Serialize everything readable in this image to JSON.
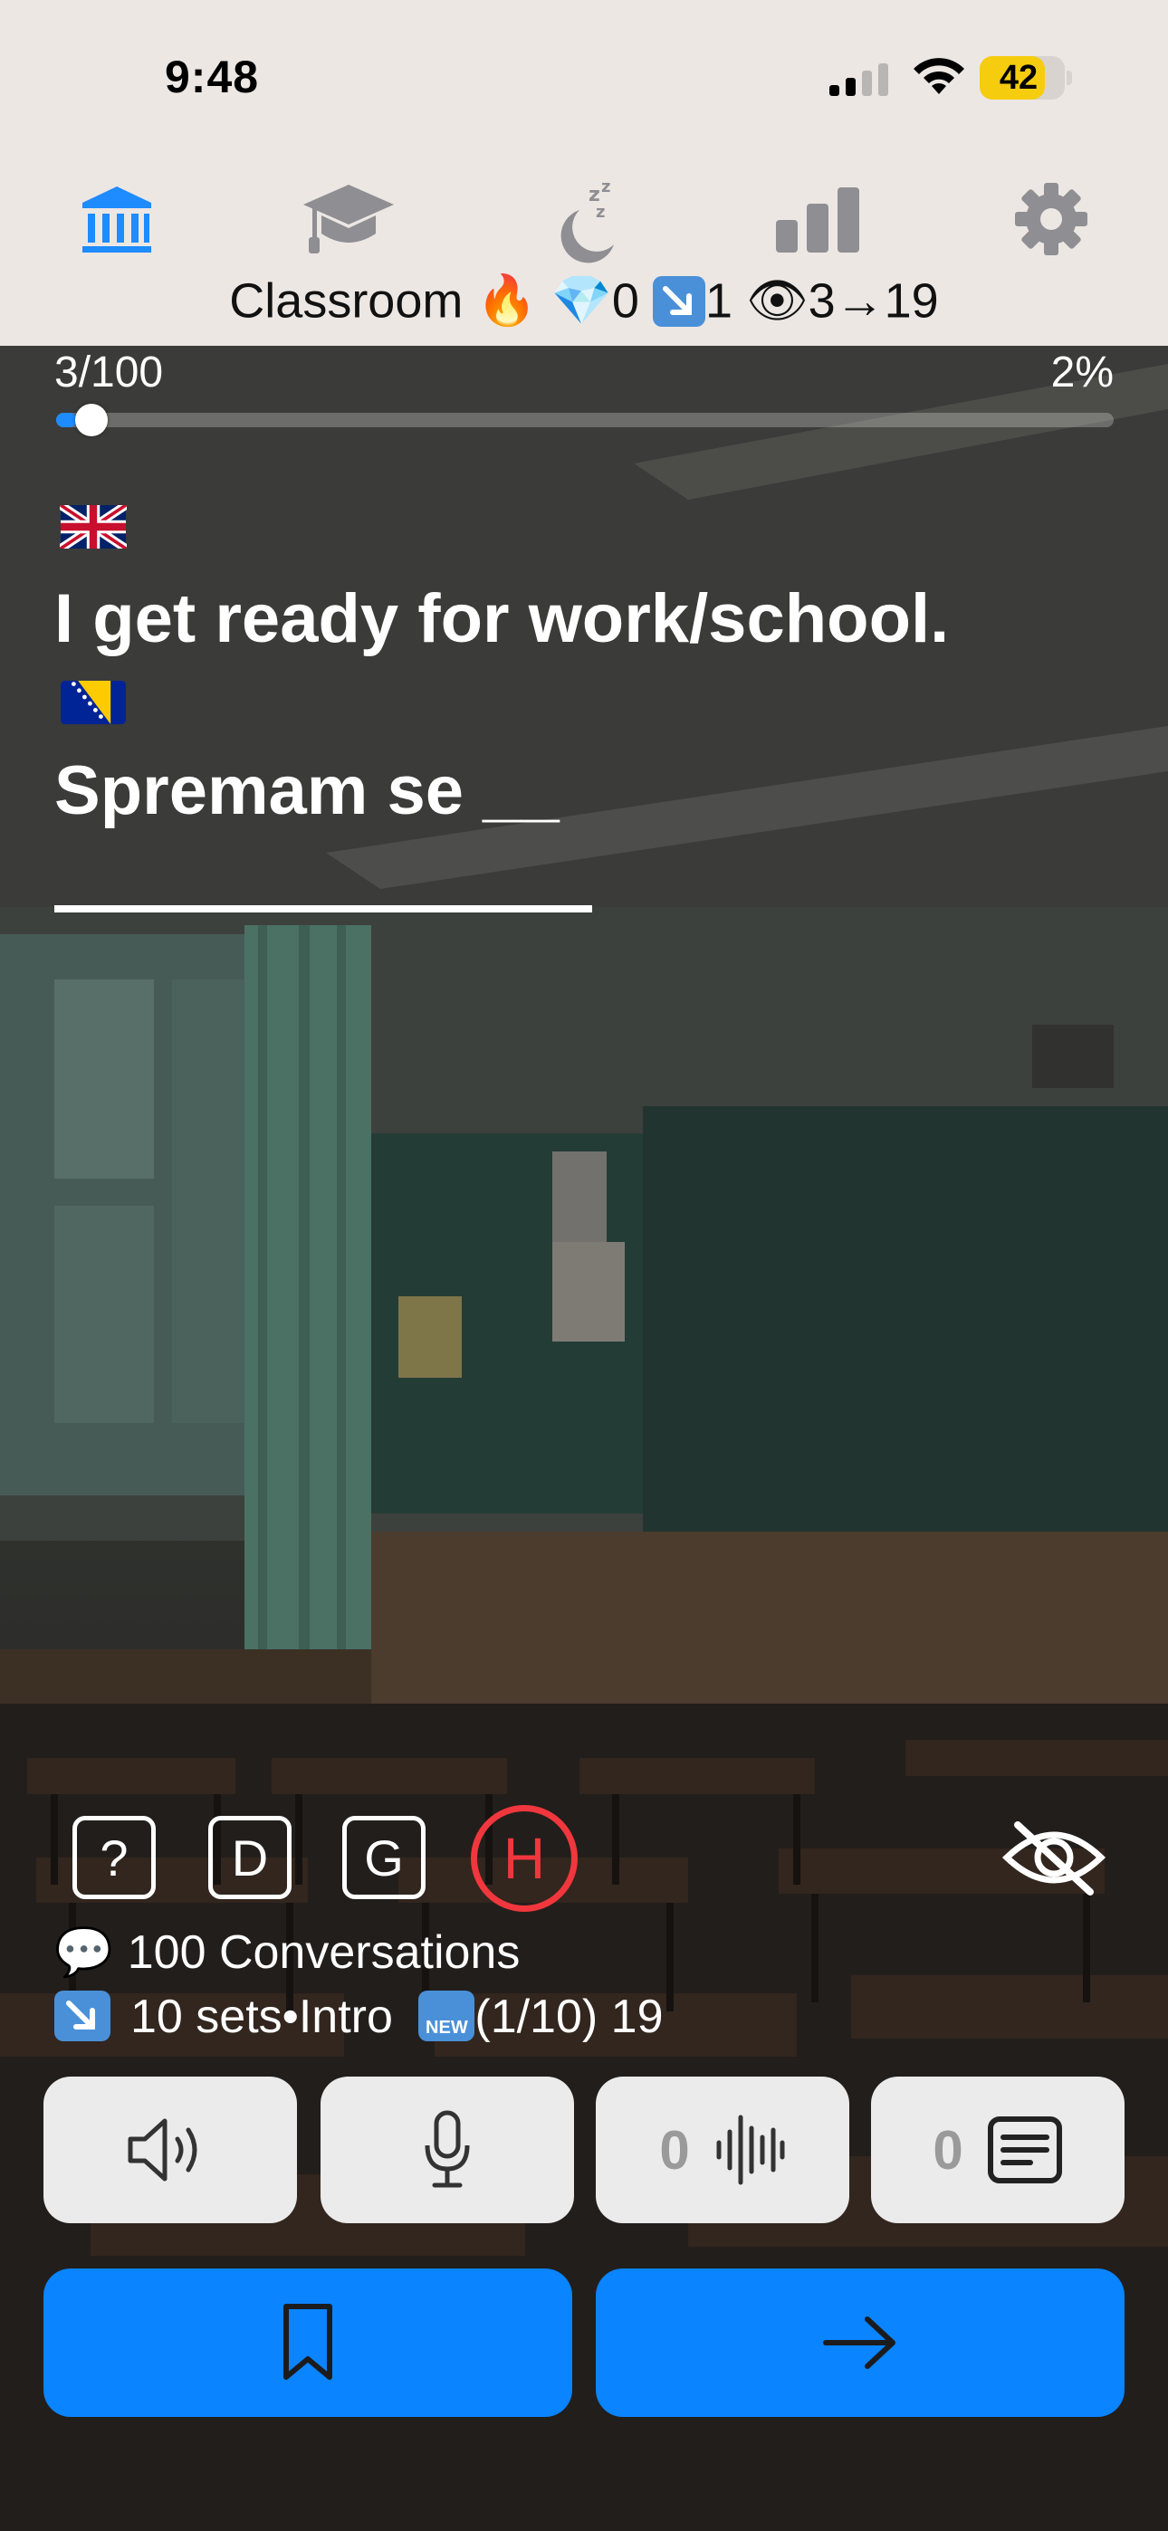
{
  "status_bar": {
    "time": "9:48",
    "battery_percent": "42",
    "signal_icon": "cellular-signal-icon",
    "wifi_icon": "wifi-icon"
  },
  "nav": {
    "tabs": [
      {
        "name": "classroom",
        "icon": "museum-columns-icon",
        "active": true
      },
      {
        "name": "courses",
        "icon": "graduation-cap-icon",
        "active": false
      },
      {
        "name": "sleep",
        "icon": "moon-zzz-icon",
        "active": false
      },
      {
        "name": "stats",
        "icon": "bar-chart-icon",
        "active": false
      },
      {
        "name": "settings",
        "icon": "gear-icon",
        "active": false
      }
    ],
    "title": "Classroom",
    "streak_emoji": "🔥",
    "gems_emoji": "💎",
    "gems_count": "0",
    "sets_count": "1",
    "view_emoji": "👁",
    "view_text": "3→19"
  },
  "progress": {
    "position": "3/100",
    "percent": "2%",
    "fraction": 0.02
  },
  "exercise": {
    "source_flag": "🇬🇧",
    "source_sentence": "I get ready for work/school.",
    "target_flag": "🇧🇦",
    "target_prompt": "Spremam se __"
  },
  "hints": {
    "question_label": "?",
    "d_label": "D",
    "g_label": "G",
    "h_label": "H"
  },
  "course_info": {
    "conversations_emoji": "💬",
    "conversations_text": "100 Conversations",
    "sets_text": "10 sets•Intro",
    "new_badge": "NEW",
    "sets_progress": "(1/10) 19"
  },
  "actions": {
    "audio_count": "0",
    "text_count": "0"
  },
  "colors": {
    "accent_blue": "#0a84ff",
    "inactive_gray": "#8e8e93",
    "hint_red": "#f0373d",
    "header_bg": "#ece7e3",
    "battery_yellow": "#f6cc0f"
  }
}
